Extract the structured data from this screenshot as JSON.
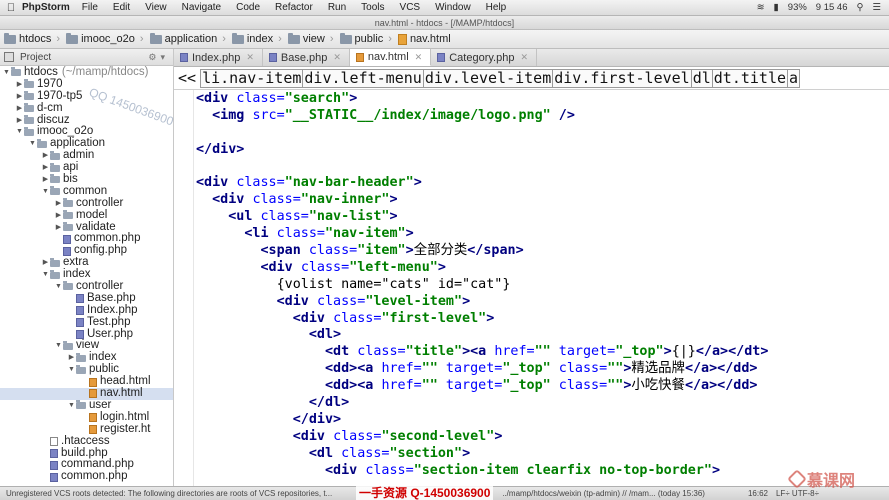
{
  "menubar": {
    "app": "PhpStorm",
    "items": [
      "File",
      "Edit",
      "View",
      "Navigate",
      "Code",
      "Refactor",
      "Run",
      "Tools",
      "VCS",
      "Window",
      "Help"
    ],
    "battery": "93%",
    "clock": "9 15 46"
  },
  "window_title": "nav.html - htdocs - [/MAMP/htdocs]",
  "breadcrumbs": [
    "htdocs",
    "imooc_o2o",
    "application",
    "index",
    "view",
    "public",
    "nav.html"
  ],
  "project": {
    "label": "Project",
    "tree": [
      {
        "label": "htdocs",
        "extra": "(~/mamp/htdocs)",
        "depth": 0,
        "type": "folder",
        "open": true
      },
      {
        "label": "1970",
        "depth": 1,
        "type": "folder",
        "open": false
      },
      {
        "label": "1970-tp5",
        "depth": 1,
        "type": "folder",
        "open": false
      },
      {
        "label": "d-cm",
        "depth": 1,
        "type": "folder",
        "open": false
      },
      {
        "label": "discuz",
        "depth": 1,
        "type": "folder",
        "open": false
      },
      {
        "label": "imooc_o2o",
        "depth": 1,
        "type": "folder",
        "open": true
      },
      {
        "label": "application",
        "depth": 2,
        "type": "folder",
        "open": true
      },
      {
        "label": "admin",
        "depth": 3,
        "type": "folder",
        "open": false
      },
      {
        "label": "api",
        "depth": 3,
        "type": "folder",
        "open": false
      },
      {
        "label": "bis",
        "depth": 3,
        "type": "folder",
        "open": false
      },
      {
        "label": "common",
        "depth": 3,
        "type": "folder",
        "open": true
      },
      {
        "label": "controller",
        "depth": 4,
        "type": "folder",
        "open": false
      },
      {
        "label": "model",
        "depth": 4,
        "type": "folder",
        "open": false
      },
      {
        "label": "validate",
        "depth": 4,
        "type": "folder",
        "open": false
      },
      {
        "label": "common.php",
        "depth": 4,
        "type": "php"
      },
      {
        "label": "config.php",
        "depth": 4,
        "type": "php"
      },
      {
        "label": "extra",
        "depth": 3,
        "type": "folder",
        "open": false
      },
      {
        "label": "index",
        "depth": 3,
        "type": "folder",
        "open": true
      },
      {
        "label": "controller",
        "depth": 4,
        "type": "folder",
        "open": true
      },
      {
        "label": "Base.php",
        "depth": 5,
        "type": "php"
      },
      {
        "label": "Index.php",
        "depth": 5,
        "type": "php"
      },
      {
        "label": "Test.php",
        "depth": 5,
        "type": "php"
      },
      {
        "label": "User.php",
        "depth": 5,
        "type": "php"
      },
      {
        "label": "view",
        "depth": 4,
        "type": "folder",
        "open": true
      },
      {
        "label": "index",
        "depth": 5,
        "type": "folder",
        "open": false
      },
      {
        "label": "public",
        "depth": 5,
        "type": "folder",
        "open": true
      },
      {
        "label": "head.html",
        "depth": 6,
        "type": "html"
      },
      {
        "label": "nav.html",
        "depth": 6,
        "type": "html",
        "selected": true
      },
      {
        "label": "user",
        "depth": 5,
        "type": "folder",
        "open": true
      },
      {
        "label": "login.html",
        "depth": 6,
        "type": "html"
      },
      {
        "label": "register.ht",
        "depth": 6,
        "type": "html"
      },
      {
        "label": ".htaccess",
        "depth": 3,
        "type": "text"
      },
      {
        "label": "build.php",
        "depth": 3,
        "type": "php"
      },
      {
        "label": "command.php",
        "depth": 3,
        "type": "php"
      },
      {
        "label": "common.php",
        "depth": 3,
        "type": "php"
      }
    ]
  },
  "tabs": [
    {
      "label": "Index.php",
      "kind": "php"
    },
    {
      "label": "Base.php",
      "kind": "php"
    },
    {
      "label": "nav.html",
      "kind": "html",
      "active": true
    },
    {
      "label": "Category.php",
      "kind": "php"
    }
  ],
  "editor_breadcrumbs": {
    "lead": "<<",
    "segments": [
      "li.nav-item",
      "div.left-menu",
      "div.level-item",
      "div.first-level",
      "dl",
      "dt.title",
      "a"
    ]
  },
  "code_lines": [
    [
      [
        "t",
        "<div "
      ],
      [
        "a",
        "class="
      ],
      [
        "s",
        "\"search\""
      ],
      [
        "t",
        ">"
      ]
    ],
    [
      [
        "t",
        "  <img "
      ],
      [
        "a",
        "src="
      ],
      [
        "s",
        "\"__STATIC__/index/image/logo.png\""
      ],
      [
        "t",
        " />"
      ]
    ],
    [],
    [
      [
        "t",
        "</div>"
      ]
    ],
    [],
    [
      [
        "t",
        "<div "
      ],
      [
        "a",
        "class="
      ],
      [
        "s",
        "\"nav-bar-header\""
      ],
      [
        "t",
        ">"
      ]
    ],
    [
      [
        "t",
        "  <div "
      ],
      [
        "a",
        "class="
      ],
      [
        "s",
        "\"nav-inner\""
      ],
      [
        "t",
        ">"
      ]
    ],
    [
      [
        "t",
        "    <ul "
      ],
      [
        "a",
        "class="
      ],
      [
        "s",
        "\"nav-list\""
      ],
      [
        "t",
        ">"
      ]
    ],
    [
      [
        "t",
        "      <li "
      ],
      [
        "a",
        "class="
      ],
      [
        "s",
        "\"nav-item\""
      ],
      [
        "t",
        ">"
      ]
    ],
    [
      [
        "t",
        "        <span "
      ],
      [
        "a",
        "class="
      ],
      [
        "s",
        "\"item\""
      ],
      [
        "t",
        ">"
      ],
      [
        "x",
        "全部分类"
      ],
      [
        "t",
        "</span>"
      ]
    ],
    [
      [
        "t",
        "        <div "
      ],
      [
        "a",
        "class="
      ],
      [
        "s",
        "\"left-menu\""
      ],
      [
        "t",
        ">"
      ]
    ],
    [
      [
        "x",
        "          {volist name=\"cats\" id=\"cat\"}"
      ]
    ],
    [
      [
        "t",
        "          <div "
      ],
      [
        "a",
        "class="
      ],
      [
        "s",
        "\"level-item\""
      ],
      [
        "t",
        ">"
      ]
    ],
    [
      [
        "t",
        "            <div "
      ],
      [
        "a",
        "class="
      ],
      [
        "s",
        "\"first-level\""
      ],
      [
        "t",
        ">"
      ]
    ],
    [
      [
        "t",
        "              <dl>"
      ]
    ],
    [
      [
        "t",
        "                <dt "
      ],
      [
        "a",
        "class="
      ],
      [
        "s",
        "\"title\""
      ],
      [
        "t",
        "><a "
      ],
      [
        "a",
        "href="
      ],
      [
        "s",
        "\"\""
      ],
      [
        "a",
        " target="
      ],
      [
        "s",
        "\"_top\""
      ],
      [
        "t",
        ">"
      ],
      [
        "x",
        "{|}"
      ],
      [
        "t",
        "</a></dt>"
      ]
    ],
    [
      [
        "t",
        "                <dd><a "
      ],
      [
        "a",
        "href="
      ],
      [
        "s",
        "\"\""
      ],
      [
        "a",
        " target="
      ],
      [
        "s",
        "\"_top\""
      ],
      [
        "a",
        " class="
      ],
      [
        "s",
        "\"\""
      ],
      [
        "t",
        ">"
      ],
      [
        "x",
        "精选品牌"
      ],
      [
        "t",
        "</a></dd>"
      ]
    ],
    [
      [
        "t",
        "                <dd><a "
      ],
      [
        "a",
        "href="
      ],
      [
        "s",
        "\"\""
      ],
      [
        "a",
        " target="
      ],
      [
        "s",
        "\"_top\""
      ],
      [
        "a",
        " class="
      ],
      [
        "s",
        "\"\""
      ],
      [
        "t",
        ">"
      ],
      [
        "x",
        "小吃快餐"
      ],
      [
        "t",
        "</a></dd>"
      ]
    ],
    [
      [
        "t",
        "              </dl>"
      ]
    ],
    [
      [
        "t",
        "            </div>"
      ]
    ],
    [
      [
        "t",
        "            <div "
      ],
      [
        "a",
        "class="
      ],
      [
        "s",
        "\"second-level\""
      ],
      [
        "t",
        ">"
      ]
    ],
    [
      [
        "t",
        "              <dl "
      ],
      [
        "a",
        "class="
      ],
      [
        "s",
        "\"section\""
      ],
      [
        "t",
        ">"
      ]
    ],
    [
      [
        "t",
        "                <div "
      ],
      [
        "a",
        "class="
      ],
      [
        "s",
        "\"section-item clearfix no-top-border\""
      ],
      [
        "t",
        ">"
      ]
    ]
  ],
  "statusbar": {
    "message": "Unregistered VCS roots detected: The following directories are roots of VCS repositories, t...",
    "path": "../mamp/htdocs/weixin (tp-admin) // /mam... (today 15:36)",
    "position": "16:62",
    "encoding": "LF÷ UTF-8÷"
  },
  "watermarks": {
    "qq": "QQ 1450036900",
    "bottom": "一手资源 Q-1450036900",
    "corner": "慕课网"
  }
}
